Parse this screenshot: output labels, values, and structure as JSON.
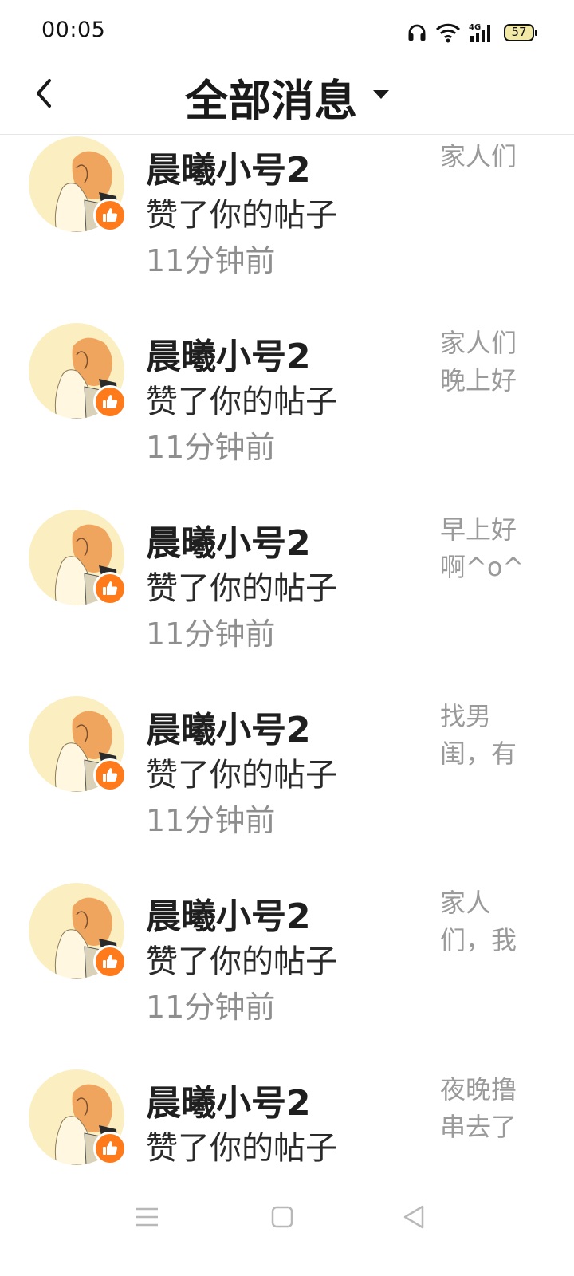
{
  "status_bar": {
    "time": "00:05",
    "network": "4G",
    "battery": "57"
  },
  "header": {
    "title": "全部消息",
    "back_icon": "chevron-left-icon",
    "dropdown_icon": "caret-down-icon"
  },
  "colors": {
    "like_badge": "#ff7a1a",
    "secondary_text": "#8e8e8e",
    "preview_text": "#9a9a9a"
  },
  "messages": [
    {
      "name": "晨曦小号2",
      "action": "赞了你的帖子",
      "time": "11分钟前",
      "preview": "家人们"
    },
    {
      "name": "晨曦小号2",
      "action": "赞了你的帖子",
      "time": "11分钟前",
      "preview": "家人们晚上好"
    },
    {
      "name": "晨曦小号2",
      "action": "赞了你的帖子",
      "time": "11分钟前",
      "preview": "早上好啊^o^~宝们"
    },
    {
      "name": "晨曦小号2",
      "action": "赞了你的帖子",
      "time": "11分钟前",
      "preview": "找男闺，有吗？"
    },
    {
      "name": "晨曦小号2",
      "action": "赞了你的帖子",
      "time": "11分钟前",
      "preview": "家人们，我超级"
    },
    {
      "name": "晨曦小号2",
      "action": "赞了你的帖子",
      "time": "11分钟前",
      "preview": "夜晚撸串去了我"
    }
  ],
  "nav_bar": {
    "menu_icon": "menu-icon",
    "home_icon": "home-square-icon",
    "back_icon": "back-triangle-icon"
  }
}
